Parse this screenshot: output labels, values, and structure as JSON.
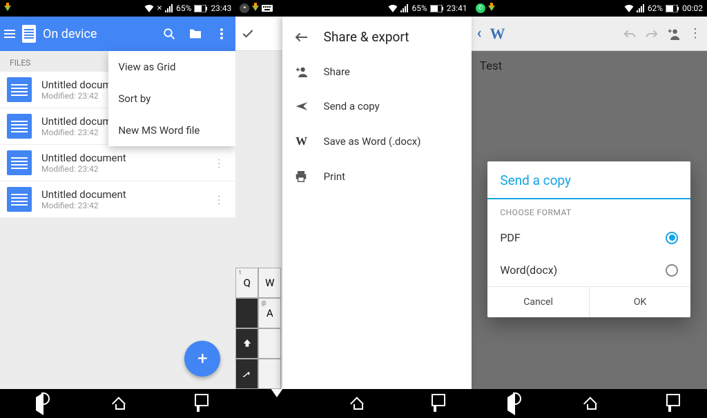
{
  "pane1": {
    "status": {
      "battery": "65%",
      "time": "23:43"
    },
    "toolbar": {
      "title": "On device"
    },
    "section": "FILES",
    "files": [
      {
        "title": "Untitled document",
        "modified": "Modified: 23:42"
      },
      {
        "title": "Untitled document",
        "modified": "Modified: 23:42"
      },
      {
        "title": "Untitled document",
        "modified": "Modified: 23:42"
      },
      {
        "title": "Untitled document",
        "modified": "Modified: 23:42"
      }
    ],
    "menu": {
      "view_grid": "View as Grid",
      "sort": "Sort by",
      "new_word": "New MS Word file"
    }
  },
  "pane2": {
    "status": {
      "battery": "65%",
      "time": "23:41"
    },
    "drawer": {
      "title": "Share & export",
      "share": "Share",
      "send_copy": "Send a copy",
      "save_word": "Save as Word (.docx)",
      "print": "Print"
    },
    "kb": {
      "q": "Q",
      "w": "W",
      "a": "A"
    }
  },
  "pane3": {
    "status": {
      "battery": "62%",
      "time": "00:02"
    },
    "doc_title": "Test",
    "dialog": {
      "title": "Send a copy",
      "subtitle": "CHOOSE FORMAT",
      "opt_pdf": "PDF",
      "opt_word": "Word(docx)",
      "cancel": "Cancel",
      "ok": "OK"
    }
  }
}
